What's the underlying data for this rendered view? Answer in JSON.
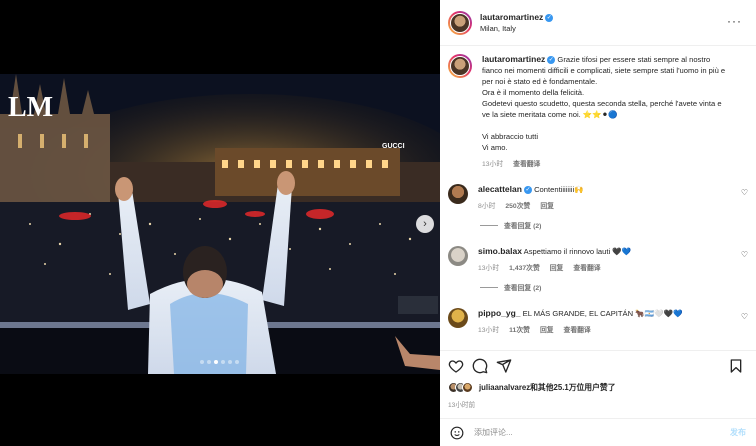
{
  "post": {
    "username": "lautaromartinez",
    "location": "Milan, Italy",
    "more_icon": "more-horizontal-icon"
  },
  "media": {
    "brand_logo_text": "LM",
    "storefront_sign": "GUCCI",
    "carousel_total": 6,
    "carousel_active_index": 2
  },
  "caption": {
    "text": "Grazie tifosi per essere stati sempre al nostro fianco nei momenti difficili e complicati, siete sempre stati l'uomo in più e per noi è stato ed è fondamentale.\nOra è il momento della felicità.\nGodetevi questo scudetto, questa seconda stella, perché l'avete vinta e ve la siete meritata come noi. ⭐⭐⚫🔵\n\nVi abbraccio tutti\nVi amo.",
    "time": "13小时",
    "translate": "查看翻译"
  },
  "comments": [
    {
      "username": "alecattelan",
      "verified": true,
      "text": "Contentiiiiiiii🙌",
      "time": "8小时",
      "likes": "250次赞",
      "reply": "回复",
      "translate": "",
      "view_replies": "查看回复 (2)"
    },
    {
      "username": "simo.balax",
      "verified": false,
      "text": "Aspettiamo il rinnovo lauti 🖤💙",
      "time": "13小时",
      "likes": "1,437次赞",
      "reply": "回复",
      "translate": "查看翻译",
      "view_replies": "查看回复 (2)"
    },
    {
      "username": "pippo_yg_",
      "verified": false,
      "text": "EL MÁS GRANDE, EL CAPITÁN 🐂🇦🇷🤍🖤💙",
      "time": "13小时",
      "likes": "11次赞",
      "reply": "回复",
      "translate": "查看翻译",
      "view_replies": ""
    }
  ],
  "likes_summary": {
    "text": "juliaanalvarez和其他25.1万位用户赞了"
  },
  "post_time": "13小时前",
  "comment_box": {
    "placeholder": "添加评论...",
    "post_label": "发布"
  },
  "colors": {
    "verified": "#3897f0",
    "post_disabled": "#b2dffc"
  }
}
